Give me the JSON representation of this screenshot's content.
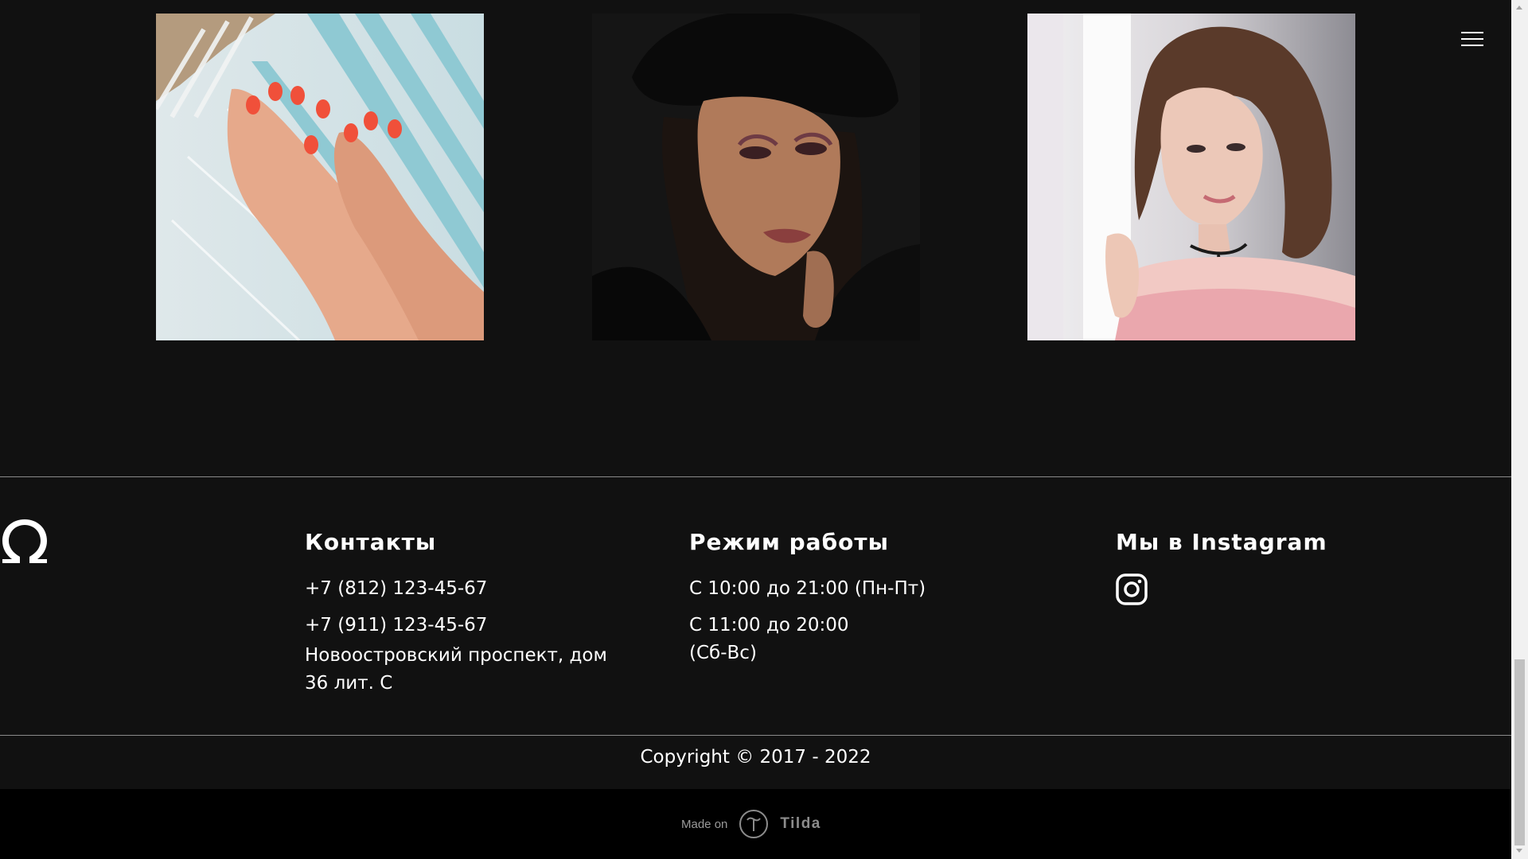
{
  "colors": {
    "background": "#111111",
    "text": "#ffffff",
    "divider": "#8a8a8a",
    "madeon_bar": "#000000",
    "madeon_text": "#9a9a9a"
  },
  "header": {
    "menu_icon": "hamburger-menu-icon"
  },
  "gallery": {
    "images": [
      {
        "subject": "manicured hands on striped blanket"
      },
      {
        "subject": "woman in black hat with evening makeup"
      },
      {
        "subject": "woman with choker by the window"
      }
    ]
  },
  "footer": {
    "logo_icon": "omega-logo-icon",
    "contacts": {
      "title": "Контакты",
      "phone_1": "+7 (812) 123-45-67",
      "phone_2": "+7 (911) 123-45-67",
      "address_line_1": "Новоостровский проспект, дом",
      "address_line_2": "36 лит. С"
    },
    "hours": {
      "title": "Режим работы",
      "weekdays": "С 10:00 до 21:00 (Пн-Пт)",
      "weekend_line_1": "С 11:00 до 20:00",
      "weekend_line_2": "(Сб-Вс)"
    },
    "instagram": {
      "title": "Мы в Instagram",
      "icon": "instagram-icon"
    },
    "copyright": "Copyright © 2017 - 2022"
  },
  "madeon": {
    "label": "Made on",
    "brand": "Tilda",
    "icon": "tilda-logo-icon"
  },
  "scrollbar": {
    "position": 0.97
  }
}
